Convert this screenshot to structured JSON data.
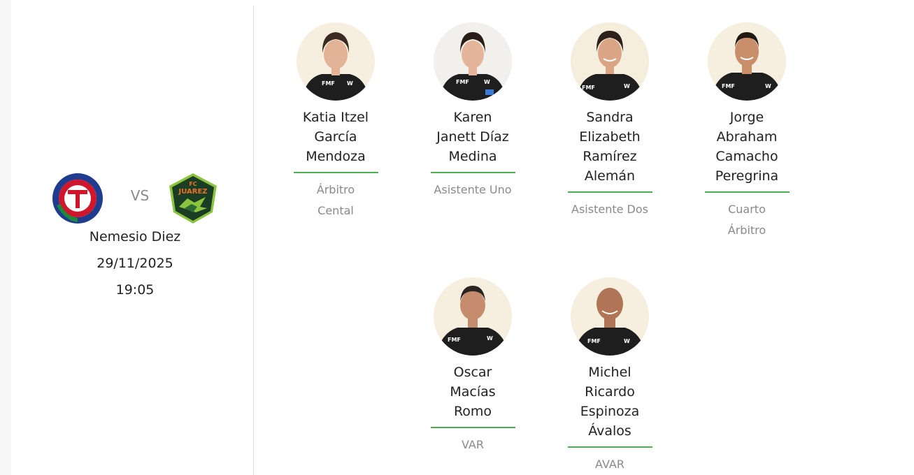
{
  "match": {
    "home_team": "Toluca",
    "away_team": "FC Juárez",
    "home_logo_text": "CLUB DEPORTIVO TOLUCA",
    "away_logo_text": "FC JUAREZ",
    "vs": "VS",
    "venue": "Nemesio Diez",
    "date": "29/11/2025",
    "time": "19:05"
  },
  "referees": [
    {
      "name_lines": [
        "Katia Itzel",
        "García",
        "Mendoza"
      ],
      "role_lines": [
        "Árbitro",
        "Cental"
      ]
    },
    {
      "name_lines": [
        "Karen",
        "Janett Díaz",
        "Medina"
      ],
      "role_lines": [
        "Asistente Uno"
      ]
    },
    {
      "name_lines": [
        "Sandra",
        "Elizabeth",
        "Ramírez",
        "Alemán"
      ],
      "role_lines": [
        "Asistente Dos"
      ]
    },
    {
      "name_lines": [
        "Jorge",
        "Abraham",
        "Camacho",
        "Peregrina"
      ],
      "role_lines": [
        "Cuarto",
        "Árbitro"
      ]
    },
    {
      "name_lines": [
        "Oscar",
        "Macías",
        "Romo"
      ],
      "role_lines": [
        "VAR"
      ]
    },
    {
      "name_lines": [
        "Michel",
        "Ricardo",
        "Espinoza",
        "Ávalos"
      ],
      "role_lines": [
        "AVAR"
      ]
    }
  ],
  "colors": {
    "accent_green": "#4caf50",
    "role_gray": "#8a8a8a",
    "toluca_red": "#d0162b",
    "juarez_green": "#1a5e2c",
    "juarez_lime": "#8bc53f"
  }
}
